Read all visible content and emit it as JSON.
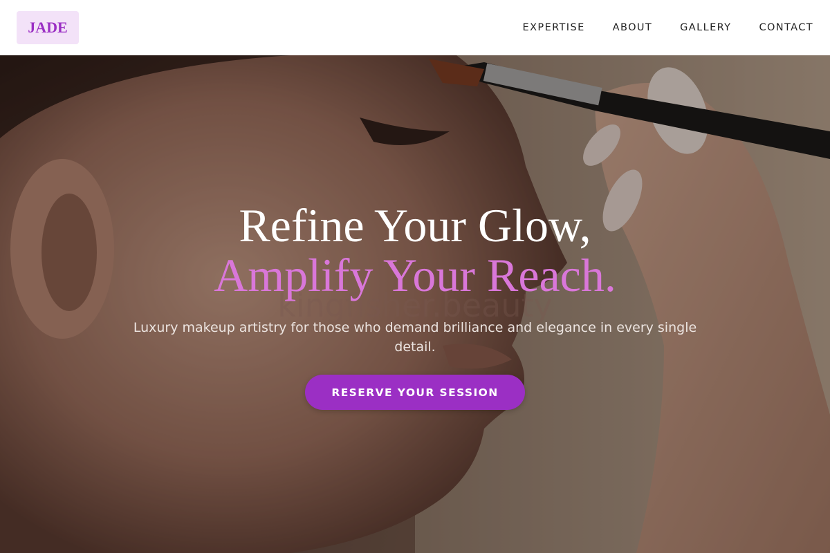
{
  "brand": {
    "logo_text": "JADE",
    "logo_bg": "#f3e2f8",
    "logo_color": "#9b2fc4"
  },
  "nav": {
    "items": [
      {
        "label": "EXPERTISE"
      },
      {
        "label": "ABOUT"
      },
      {
        "label": "GALLERY"
      },
      {
        "label": "CONTACT"
      }
    ]
  },
  "hero": {
    "headline_line1": "Refine Your Glow,",
    "headline_line2": "Amplify Your Reach.",
    "watermark": "kingfisher.beauty",
    "subtitle": "Luxury makeup artistry for those who demand brilliance and elegance in every single detail.",
    "cta_label": "RESERVE YOUR SESSION",
    "image_description_icon": "makeup-brush-portrait-photo"
  },
  "colors": {
    "accent": "#9b2fc4",
    "headline_accent": "#d977d9",
    "header_bg": "#ffffff"
  }
}
